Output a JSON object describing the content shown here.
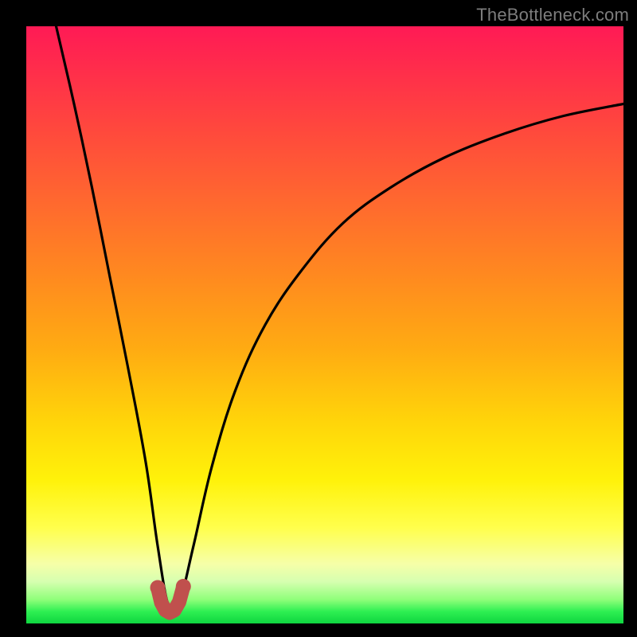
{
  "watermark": "TheBottleneck.com",
  "colors": {
    "bg": "#000000",
    "gradient_top": "#ff1a55",
    "gradient_mid": "#ffd40a",
    "gradient_bottom": "#0fd640",
    "curve": "#000000",
    "knots": "#c0504d"
  },
  "chart_data": {
    "type": "line",
    "title": "",
    "xlabel": "",
    "ylabel": "",
    "xlim": [
      0,
      100
    ],
    "ylim": [
      0,
      100
    ],
    "series": [
      {
        "name": "bottleneck-curve",
        "x": [
          5,
          8,
          11,
          14,
          17,
          20,
          22,
          23.8,
          25.5,
          28,
          31,
          35,
          40,
          46,
          53,
          61,
          70,
          80,
          90,
          100
        ],
        "y": [
          100,
          87,
          73,
          58,
          43,
          27,
          13,
          3,
          3,
          13,
          26,
          39,
          50,
          59,
          67,
          73,
          78,
          82,
          85,
          87
        ]
      }
    ],
    "knots": {
      "name": "valley-knots",
      "x": [
        22.0,
        22.6,
        23.3,
        24.0,
        24.8,
        25.6,
        26.3
      ],
      "y": [
        6.0,
        3.5,
        2.2,
        1.8,
        2.2,
        3.6,
        6.2
      ]
    }
  }
}
